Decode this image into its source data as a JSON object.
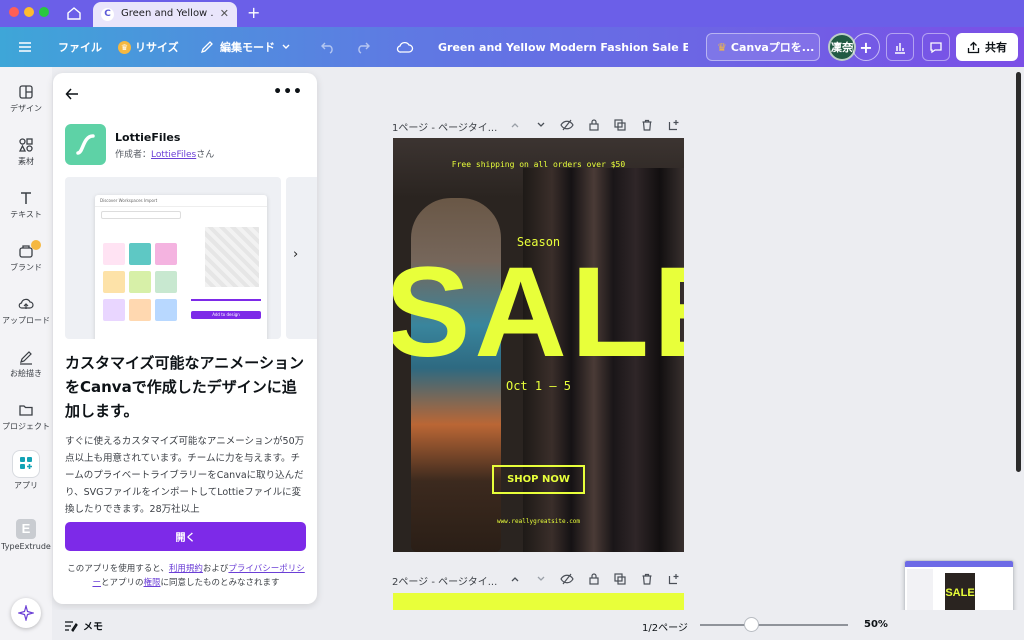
{
  "browser": {
    "tab_title": "Green and Yellow ...",
    "tab_favicon": "C"
  },
  "toolbar": {
    "file": "ファイル",
    "resize": "リサイズ",
    "edit_mode": "編集モード",
    "doc_title": "Green and Yellow Modern Fashion Sale Email Ne...",
    "pro": "Canvaプロを...",
    "avatar": "凜奈",
    "plus": "+",
    "share": "共有"
  },
  "rail": {
    "design": "デザイン",
    "elements": "素材",
    "text": "テキスト",
    "brand": "ブランド",
    "uploads": "アップロード",
    "draw": "お絵描き",
    "projects": "プロジェクト",
    "apps": "アプリ",
    "typeextrude": "TypeExtrude",
    "typeextrude_letter": "E"
  },
  "panel": {
    "app_name": "LottieFiles",
    "author_prefix": "作成者：",
    "author_link": "LottieFiles",
    "author_suffix": "さん",
    "headline": "カスタマイズ可能なアニメーションをCanvaで作成したデザインに追加します。",
    "description": "すぐに使えるカスタマイズ可能なアニメーションが50万点以上も用意されています。チームに力を与えます。チームのプライベートライブラリーをCanvaに取り込んだり、SVGファイルをインポートしてLottieファイルに変換したりできます。28万社以上",
    "open_button": "開く",
    "legal_1": "このアプリを使用すると、",
    "legal_terms": "利用規約",
    "legal_2": "および",
    "legal_privacy": "プライバシーポリシー",
    "legal_3": "とアプリの",
    "legal_permissions": "権限",
    "legal_4": "に同意したものとみなされます",
    "mock": {
      "tabs": "Discover   Workspaces   Import",
      "button": "Add to design"
    }
  },
  "canvas": {
    "page1_label": "1ページ - ページタイ...",
    "page2_label": "2ページ - ページタイ...",
    "design": {
      "shipping": "Free shipping on all orders over $50",
      "season": "Season",
      "sale": "SALE",
      "dates": "Oct 1 – 5",
      "cta": "SHOP NOW",
      "url": "www.reallygreatsite.com"
    }
  },
  "bottom": {
    "notes": "メモ",
    "pages": "1/2ページ",
    "zoom": "50%",
    "zoom_level_fraction": 0.35
  },
  "colors": {
    "accent": "#7d2ae8",
    "sale_yellow": "#e8ff3a",
    "lottie_green": "#5ed2a6"
  }
}
